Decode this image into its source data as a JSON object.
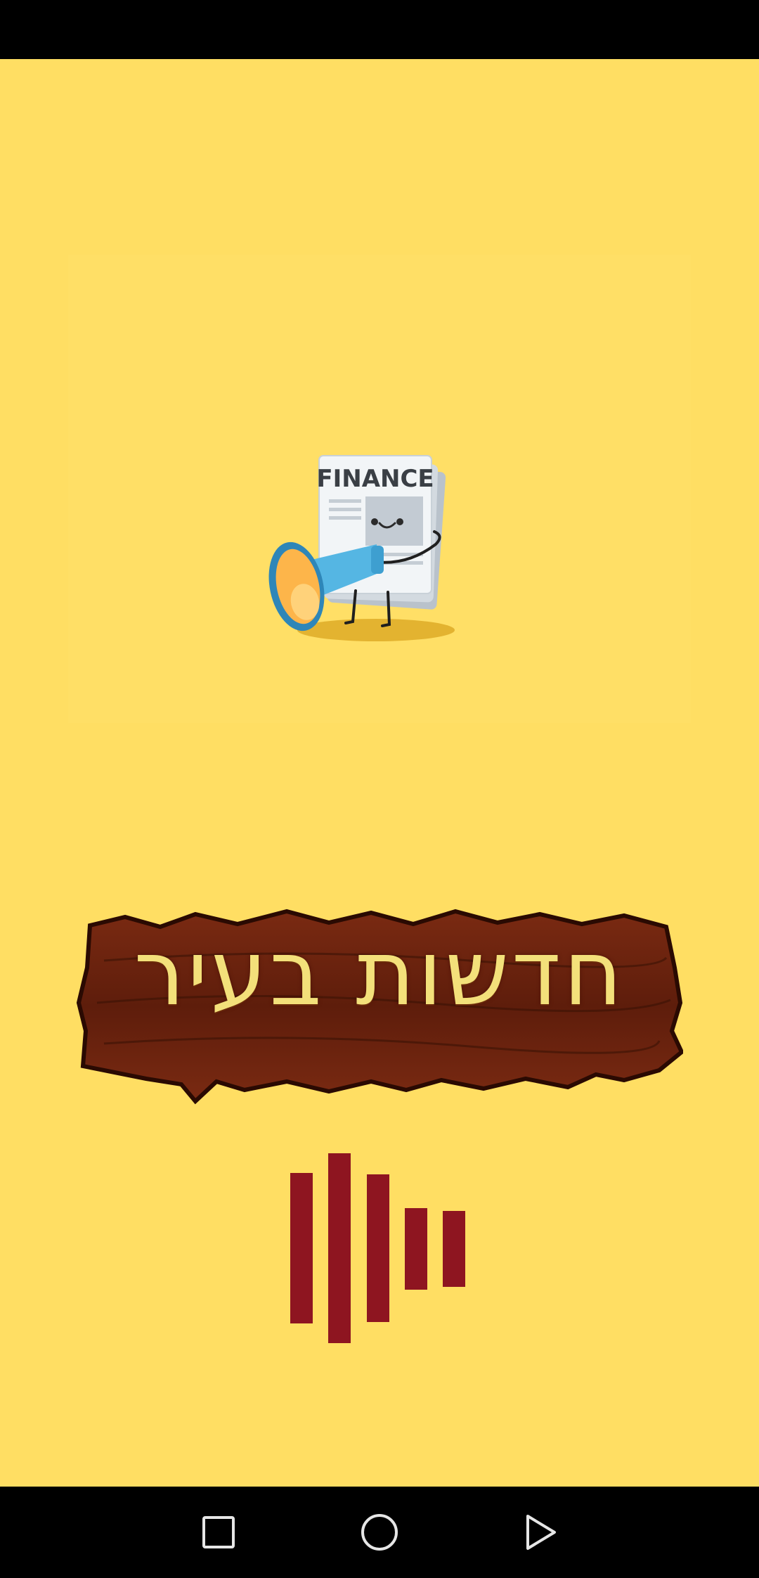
{
  "app": {
    "illustration_headline": "FINANCE",
    "sign_title": "חדשות בעיר"
  },
  "loading_indicator": {
    "bar_count": 5
  },
  "colors": {
    "background": "#FFDE63",
    "loader": "#8E1520",
    "sign_text": "#F3E07A",
    "sign_wood": "#6E2410"
  },
  "icons": {
    "illustration": "newspaper-megaphone-mascot",
    "nav_recents": "square-icon",
    "nav_home": "circle-icon",
    "nav_back": "triangle-icon"
  }
}
